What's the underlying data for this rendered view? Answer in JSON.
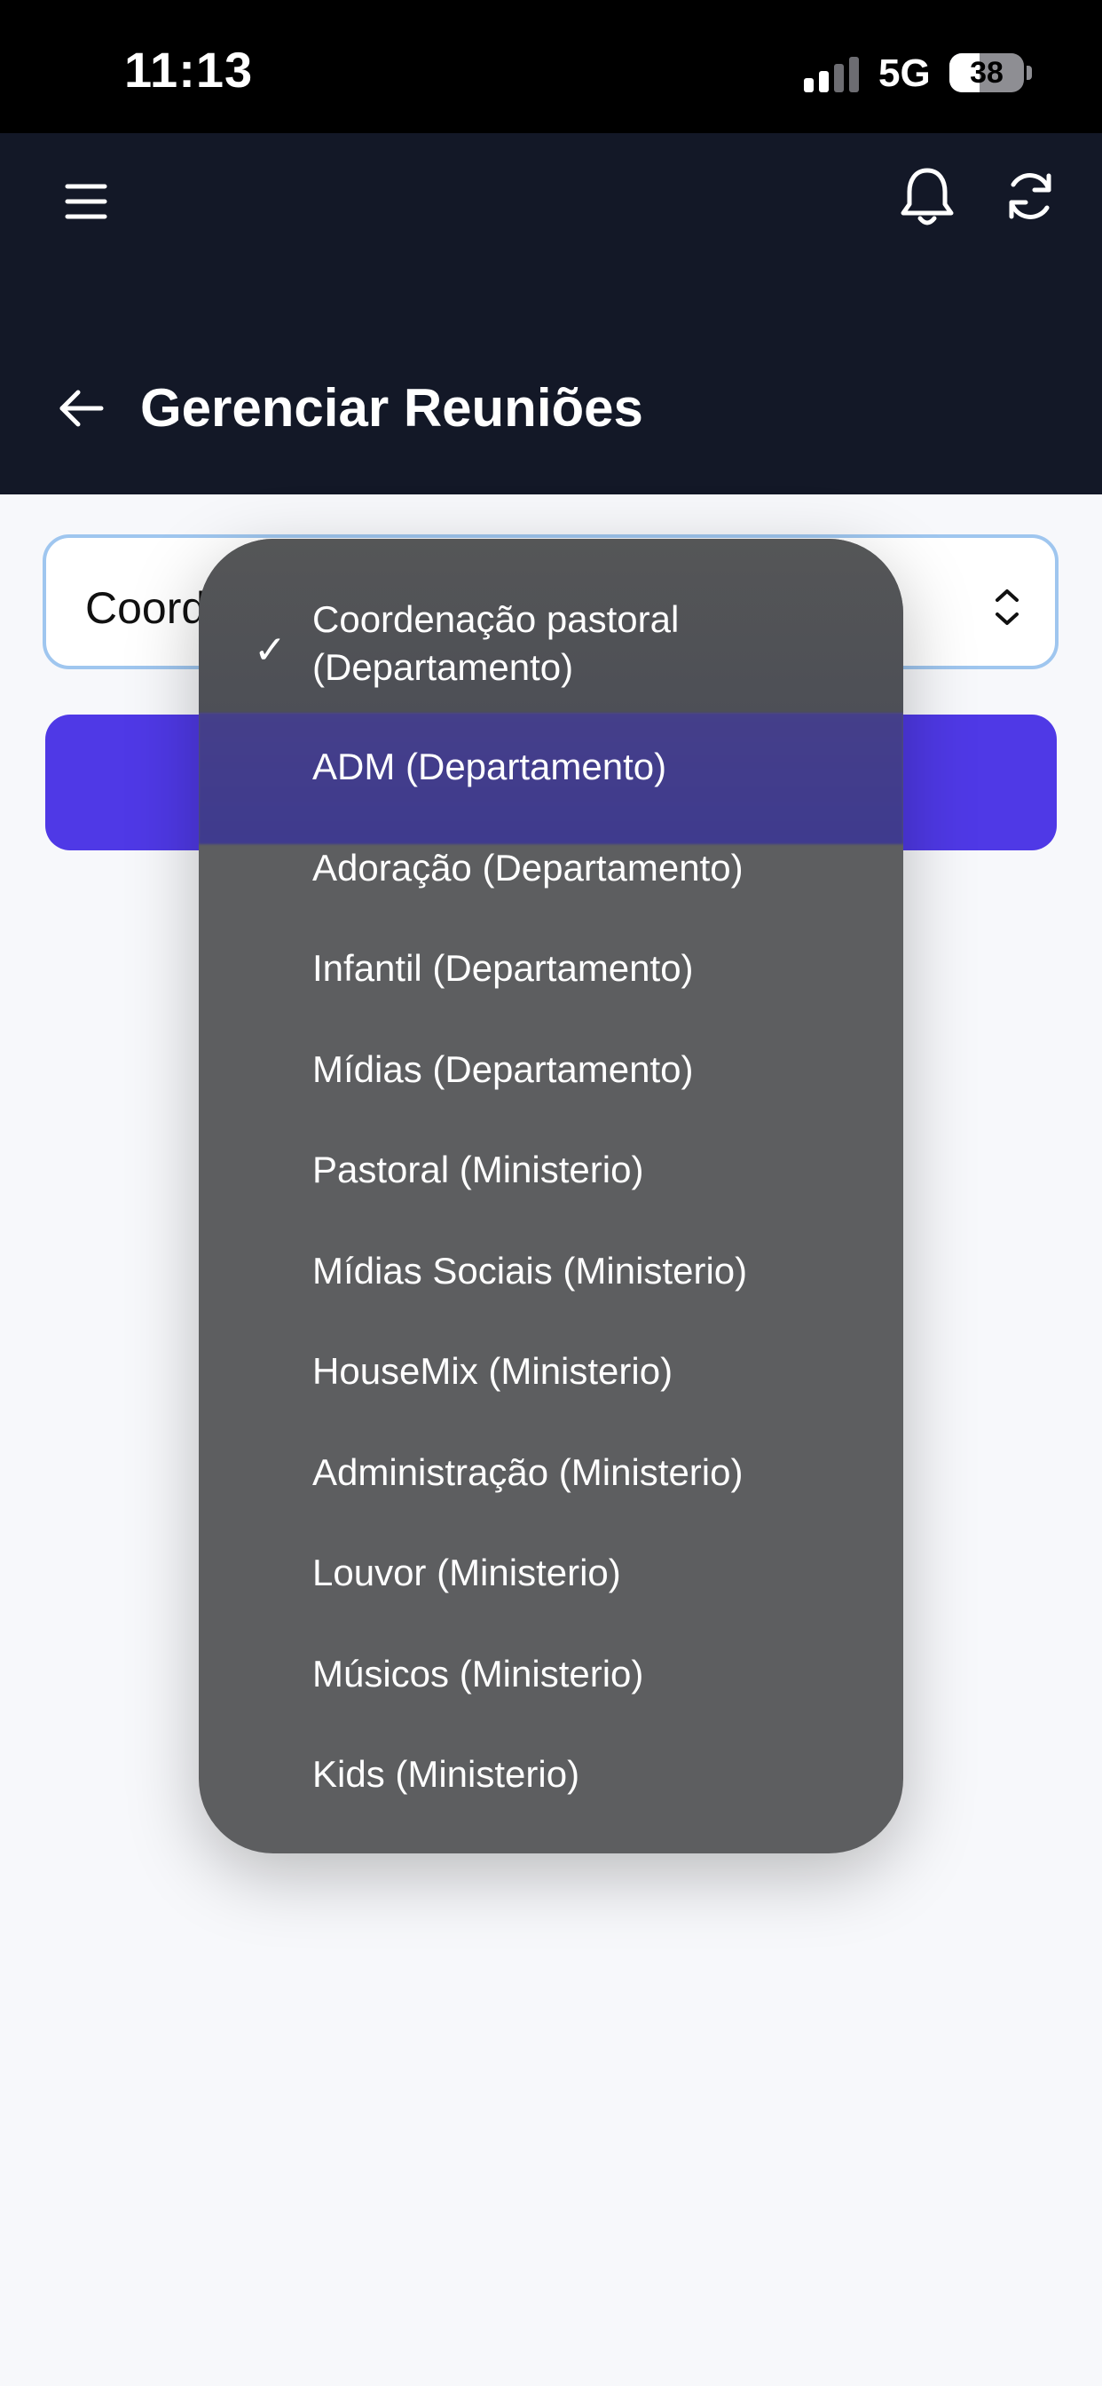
{
  "status_bar": {
    "time": "11:13",
    "network": "5G",
    "battery": "38"
  },
  "header": {
    "title": "Gerenciar Reuniões",
    "icons": [
      "menu-icon",
      "bell-icon",
      "refresh-icon",
      "back-arrow-icon"
    ],
    "background_color": "#131827"
  },
  "select": {
    "visible_value": "Coord",
    "chevron": "up-down-chevron-icon"
  },
  "primary_button": {
    "label": "",
    "color": "#4f39e6"
  },
  "dropdown": {
    "selected_index": 0,
    "highlighted_index": 1,
    "options": [
      "Coordenação pastoral (Departamento)",
      "ADM (Departamento)",
      "Adoração (Departamento)",
      "Infantil (Departamento)",
      "Mídias (Departamento)",
      "Pastoral (Ministerio)",
      "Mídias Sociais (Ministerio)",
      "HouseMix (Ministerio)",
      "Administração (Ministerio)",
      "Louvor (Ministerio)",
      "Músicos (Ministerio)",
      "Kids (Ministerio)"
    ],
    "check_mark": "✓"
  }
}
